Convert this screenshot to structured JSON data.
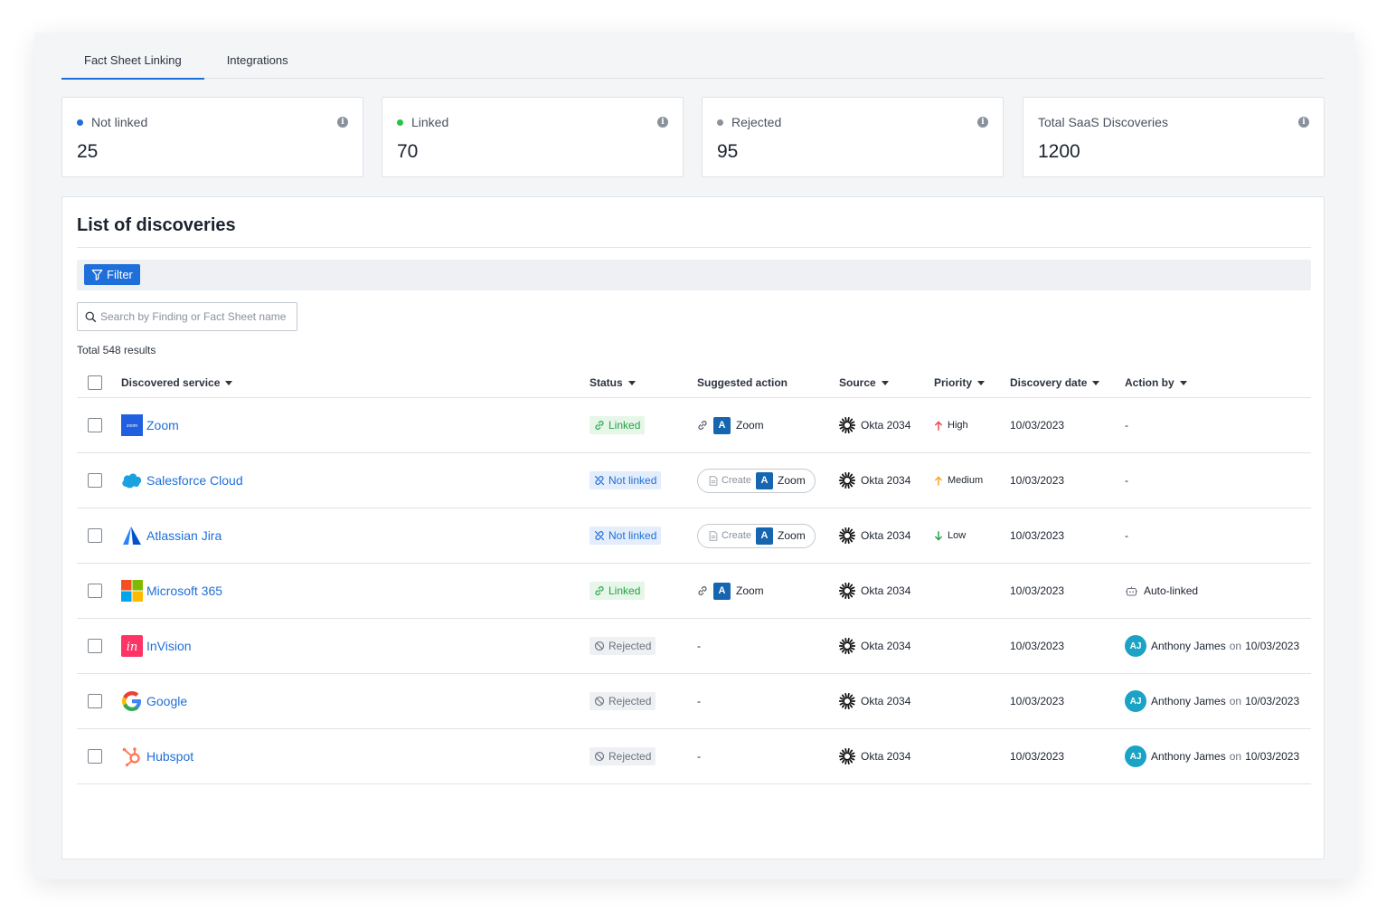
{
  "tabs": [
    {
      "label": "Fact Sheet Linking",
      "active": true
    },
    {
      "label": "Integrations",
      "active": false
    }
  ],
  "stats": [
    {
      "label": "Not linked",
      "value": "25",
      "dot_color": "#1e6fd9"
    },
    {
      "label": "Linked",
      "value": "70",
      "dot_color": "#25c444"
    },
    {
      "label": "Rejected",
      "value": "95",
      "dot_color": "#8a919c"
    },
    {
      "label": "Total SaaS Discoveries",
      "value": "1200",
      "dot_color": ""
    }
  ],
  "panel": {
    "title": "List of discoveries",
    "filter_label": "Filter",
    "search_placeholder": "Search by Finding or Fact Sheet name",
    "total_text": "Total 548 results"
  },
  "columns": {
    "service": "Discovered service",
    "status": "Status",
    "suggested": "Suggested action",
    "source": "Source",
    "priority": "Priority",
    "date": "Discovery date",
    "action_by": "Action by"
  },
  "colors": {
    "accent": "#1e6fd9",
    "linked": "#25a244",
    "high": "#e5484d",
    "medium": "#f5a623",
    "low": "#25a244"
  },
  "rows": [
    {
      "service": "Zoom",
      "logo": "zoom-logo",
      "status": "Linked",
      "status_type": "linked",
      "suggested_type": "link",
      "suggested_name": "Zoom",
      "create_label": "",
      "source": "Okta 2034",
      "priority": "High",
      "priority_type": "high",
      "date": "10/03/2023",
      "action_by_type": "dash",
      "action_by": "-",
      "action_initials": "",
      "action_on": "",
      "action_date": ""
    },
    {
      "service": "Salesforce Cloud",
      "logo": "salesforce-logo",
      "status": "Not linked",
      "status_type": "notlinked",
      "suggested_type": "create",
      "suggested_name": "Zoom",
      "create_label": "Create",
      "source": "Okta 2034",
      "priority": "Medium",
      "priority_type": "medium",
      "date": "10/03/2023",
      "action_by_type": "dash",
      "action_by": "-",
      "action_initials": "",
      "action_on": "",
      "action_date": ""
    },
    {
      "service": "Atlassian Jira",
      "logo": "jira-logo",
      "status": "Not linked",
      "status_type": "notlinked",
      "suggested_type": "create",
      "suggested_name": "Zoom",
      "create_label": "Create",
      "source": "Okta 2034",
      "priority": "Low",
      "priority_type": "low",
      "date": "10/03/2023",
      "action_by_type": "dash",
      "action_by": "-",
      "action_initials": "",
      "action_on": "",
      "action_date": ""
    },
    {
      "service": "Microsoft 365",
      "logo": "microsoft-logo",
      "status": "Linked",
      "status_type": "linked",
      "suggested_type": "link",
      "suggested_name": "Zoom",
      "create_label": "",
      "source": "Okta 2034",
      "priority": "",
      "priority_type": "none",
      "date": "10/03/2023",
      "action_by_type": "auto",
      "action_by": "Auto-linked",
      "action_initials": "",
      "action_on": "",
      "action_date": ""
    },
    {
      "service": "InVision",
      "logo": "invision-logo",
      "status": "Rejected",
      "status_type": "rejected",
      "suggested_type": "dash",
      "suggested_name": "-",
      "create_label": "",
      "source": "Okta 2034",
      "priority": "",
      "priority_type": "none",
      "date": "10/03/2023",
      "action_by_type": "user",
      "action_by": "Anthony James",
      "action_initials": "AJ",
      "action_on": "on",
      "action_date": "10/03/2023"
    },
    {
      "service": "Google",
      "logo": "google-logo",
      "status": "Rejected",
      "status_type": "rejected",
      "suggested_type": "dash",
      "suggested_name": "-",
      "create_label": "",
      "source": "Okta 2034",
      "priority": "",
      "priority_type": "none",
      "date": "10/03/2023",
      "action_by_type": "user",
      "action_by": "Anthony James",
      "action_initials": "AJ",
      "action_on": "on",
      "action_date": "10/03/2023"
    },
    {
      "service": "Hubspot",
      "logo": "hubspot-logo",
      "status": "Rejected",
      "status_type": "rejected",
      "suggested_type": "dash",
      "suggested_name": "-",
      "create_label": "",
      "source": "Okta 2034",
      "priority": "",
      "priority_type": "none",
      "date": "10/03/2023",
      "action_by_type": "user",
      "action_by": "Anthony James",
      "action_initials": "AJ",
      "action_on": "on",
      "action_date": "10/03/2023"
    }
  ]
}
